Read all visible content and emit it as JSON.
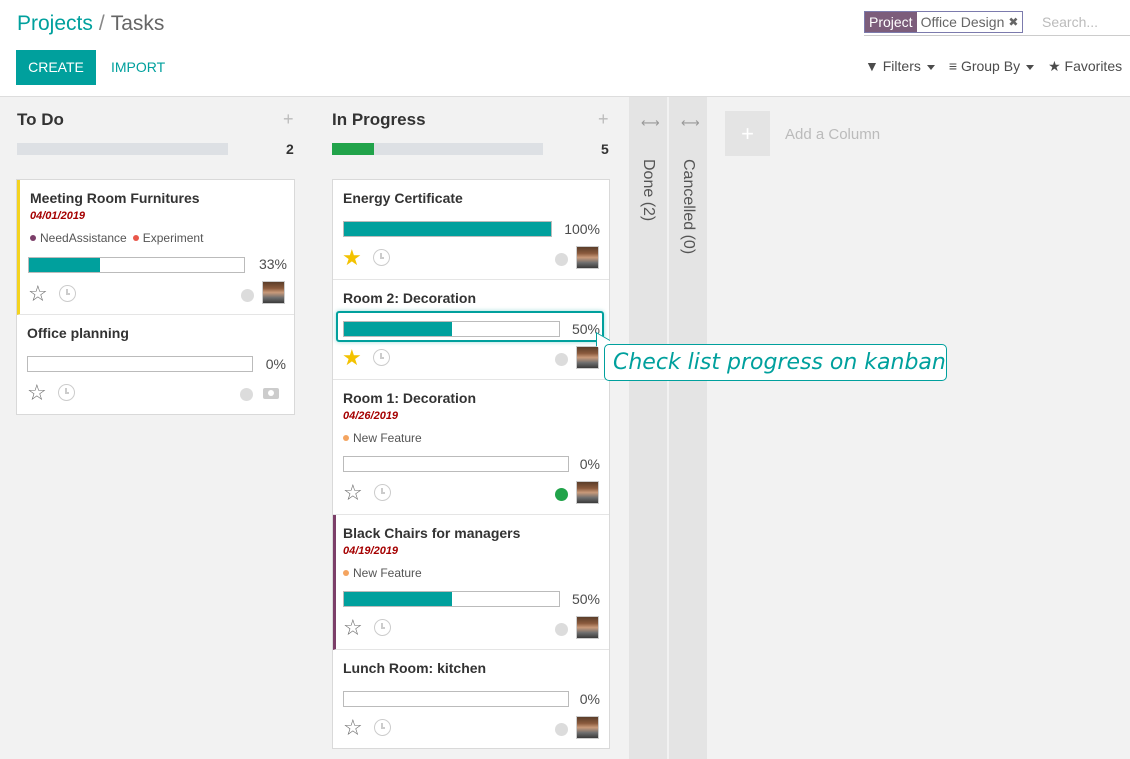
{
  "breadcrumb": {
    "parent": "Projects",
    "separator": "/",
    "current": "Tasks"
  },
  "buttons": {
    "create": "CREATE",
    "import": "IMPORT"
  },
  "search": {
    "facet_category": "Project",
    "facet_value": "Office Design",
    "facet_remove": "✖",
    "placeholder": "Search..."
  },
  "filters": {
    "filters": "Filters",
    "group_by": "Group By",
    "favorites": "Favorites"
  },
  "columns": [
    {
      "title": "To Do",
      "count": "2",
      "progress": 0,
      "add": "+",
      "cards": [
        {
          "title": "Meeting Room Furnitures",
          "date": "04/01/2019",
          "tags": [
            {
              "name": "NeedAssistance",
              "color": "#7c3f69"
            },
            {
              "name": "Experiment",
              "color": "#e9574a"
            }
          ],
          "progress": 33,
          "progress_label": "33%",
          "starred": false,
          "state": "grey",
          "avatar": true,
          "color": "yellow"
        },
        {
          "title": "Office planning",
          "date": "",
          "tags": [],
          "progress": 0,
          "progress_label": "0%",
          "starred": false,
          "state": "grey",
          "avatar": false,
          "color": ""
        }
      ]
    },
    {
      "title": "In Progress",
      "count": "5",
      "progress": 20,
      "add": "+",
      "cards": [
        {
          "title": "Energy Certificate",
          "date": "",
          "tags": [],
          "progress": 100,
          "progress_label": "100%",
          "starred": true,
          "state": "grey",
          "avatar": true,
          "color": ""
        },
        {
          "title": "Room 2: Decoration",
          "date": "",
          "tags": [],
          "progress": 50,
          "progress_label": "50%",
          "starred": true,
          "state": "grey",
          "avatar": true,
          "color": ""
        },
        {
          "title": "Room 1: Decoration",
          "date": "04/26/2019",
          "tags": [
            {
              "name": "New Feature",
              "color": "#f4a460"
            }
          ],
          "progress": 0,
          "progress_label": "0%",
          "starred": false,
          "state": "green",
          "avatar": true,
          "color": ""
        },
        {
          "title": "Black Chairs for managers",
          "date": "04/19/2019",
          "tags": [
            {
              "name": "New Feature",
              "color": "#f4a460"
            }
          ],
          "progress": 50,
          "progress_label": "50%",
          "starred": false,
          "state": "grey",
          "avatar": true,
          "color": "purple"
        },
        {
          "title": "Lunch Room: kitchen",
          "date": "",
          "tags": [],
          "progress": 0,
          "progress_label": "0%",
          "starred": false,
          "state": "grey",
          "avatar": true,
          "color": ""
        }
      ]
    }
  ],
  "folded_columns": [
    {
      "label": "Done (2)",
      "arrows": "⟷"
    },
    {
      "label": "Cancelled (0)",
      "arrows": "⟷"
    }
  ],
  "add_column": {
    "plus": "+",
    "label": "Add a Column"
  },
  "annotation": "Check list progress on kanban"
}
